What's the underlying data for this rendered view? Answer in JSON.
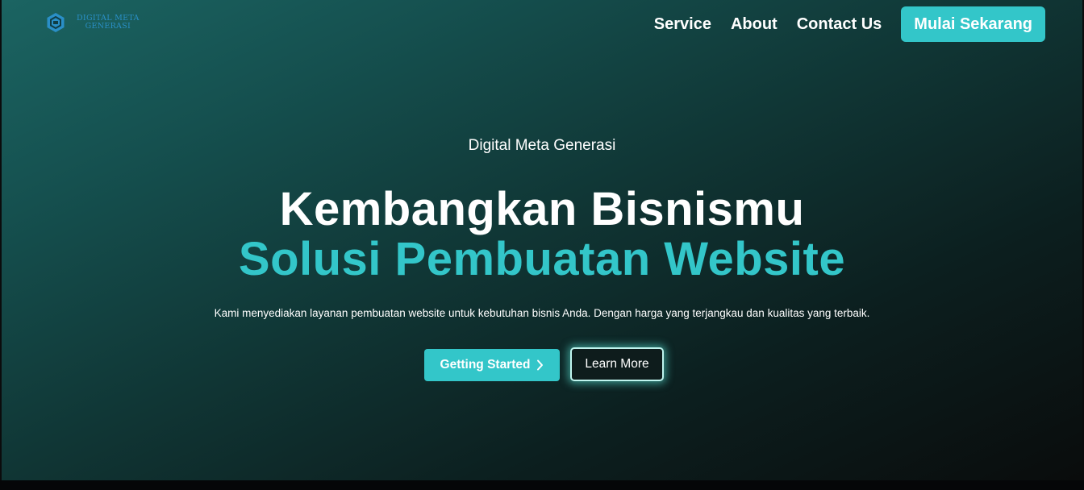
{
  "brand": {
    "logo_line1": "DIGITAL META",
    "logo_line2": "GENERASI",
    "logo_icon": "hexagon-logo-icon",
    "accent_color": "#33c6c9",
    "logo_color": "#2a8fc7"
  },
  "nav": {
    "items": [
      {
        "label": "Service"
      },
      {
        "label": "About"
      },
      {
        "label": "Contact Us"
      }
    ],
    "cta_label": "Mulai Sekarang"
  },
  "hero": {
    "eyebrow": "Digital Meta Generasi",
    "headline": "Kembangkan Bisnismu",
    "headline_accent": "Solusi Pembuatan Website",
    "description": "Kami menyediakan layanan pembuatan website untuk kebutuhan bisnis Anda. Dengan harga yang terjangkau dan kualitas yang terbaik.",
    "primary_button": "Getting Started",
    "primary_button_icon": "chevron-right-icon",
    "secondary_button": "Learn More"
  }
}
